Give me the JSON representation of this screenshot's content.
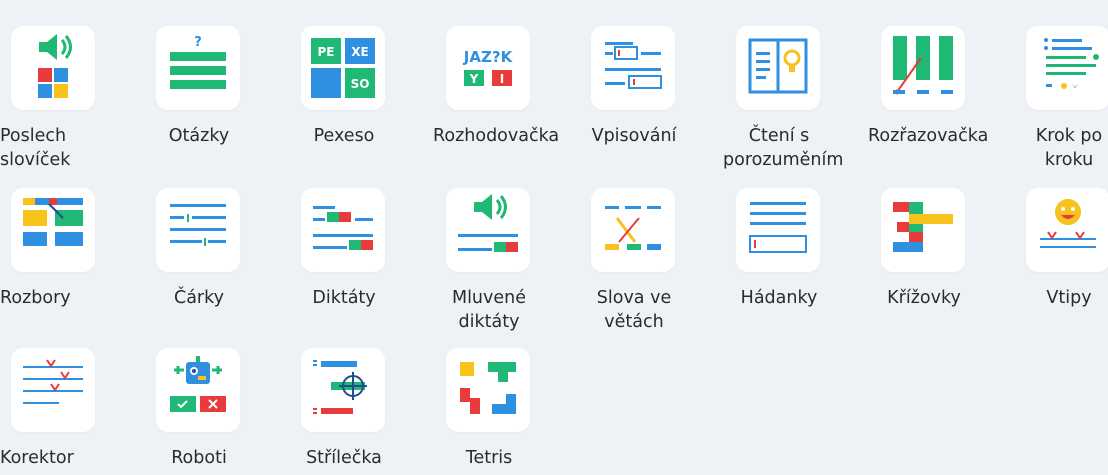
{
  "tiles": [
    {
      "label": "Poslech slovíček"
    },
    {
      "label": "Otázky"
    },
    {
      "label": "Pexeso"
    },
    {
      "label": "Rozhodovačka"
    },
    {
      "label": "Vpisování"
    },
    {
      "label": "Čtení s porozuměním"
    },
    {
      "label": "Rozřazovačka"
    },
    {
      "label": "Krok po kroku"
    },
    {
      "label": "Rozbory"
    },
    {
      "label": "Čárky"
    },
    {
      "label": "Diktáty"
    },
    {
      "label": "Mluvené diktáty"
    },
    {
      "label": "Slova ve větách"
    },
    {
      "label": "Hádanky"
    },
    {
      "label": "Křížovky"
    },
    {
      "label": "Vtipy"
    },
    {
      "label": "Korektor"
    },
    {
      "label": "Roboti"
    },
    {
      "label": "Střílečka"
    },
    {
      "label": "Tetris"
    }
  ],
  "icon_text": {
    "otazky_q": "?",
    "pexeso_pe": "PE",
    "pexeso_xe": "XE",
    "pexeso_so": "SO",
    "jazyk_title": "JAZ?K",
    "jazyk_y": "Y",
    "jazyk_i": "I"
  },
  "colors": {
    "green": "#1fb874",
    "blue": "#2f8fe0",
    "red": "#e83c3c",
    "yellow": "#f7c21b",
    "navy": "#1f4e8c",
    "background": "#eef2f7"
  }
}
